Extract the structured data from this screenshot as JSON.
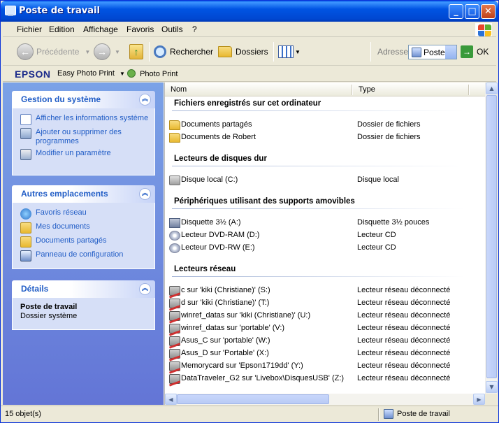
{
  "window": {
    "title": "Poste de travail"
  },
  "menu": [
    "Fichier",
    "Edition",
    "Affichage",
    "Favoris",
    "Outils",
    "?"
  ],
  "toolbar": {
    "back": "Précédente",
    "search": "Rechercher",
    "folders": "Dossiers",
    "address_label": "Adresse",
    "address_value": "Poste",
    "go": "OK"
  },
  "epson": {
    "logo": "EPSON",
    "easy_photo_print": "Easy Photo Print",
    "photo_print": "Photo Print"
  },
  "panels": {
    "system": {
      "title": "Gestion du système",
      "tasks": [
        "Afficher les informations système",
        "Ajouter ou supprimer des programmes",
        "Modifier un paramètre"
      ]
    },
    "places": {
      "title": "Autres emplacements",
      "tasks": [
        "Favoris réseau",
        "Mes documents",
        "Documents partagés",
        "Panneau de configuration"
      ]
    },
    "details": {
      "title": "Détails",
      "name": "Poste de travail",
      "type": "Dossier système"
    }
  },
  "columns": {
    "name": "Nom",
    "type": "Type"
  },
  "groups": {
    "files": {
      "title": "Fichiers enregistrés sur cet ordinateur",
      "items": [
        {
          "name": "Documents partagés",
          "type": "Dossier de fichiers"
        },
        {
          "name": "Documents de Robert",
          "type": "Dossier de fichiers"
        }
      ]
    },
    "hdd": {
      "title": "Lecteurs de disques dur",
      "items": [
        {
          "name": "Disque local (C:)",
          "type": "Disque local"
        }
      ]
    },
    "removable": {
      "title": "Périphériques utilisant des supports amovibles",
      "items": [
        {
          "name": "Disquette 3½ (A:)",
          "type": "Disquette 3½ pouces"
        },
        {
          "name": "Lecteur DVD-RAM (D:)",
          "type": "Lecteur CD"
        },
        {
          "name": "Lecteur DVD-RW (E:)",
          "type": "Lecteur CD"
        }
      ]
    },
    "network": {
      "title": "Lecteurs réseau",
      "items": [
        {
          "name": "c sur 'kiki (Christiane)' (S:)",
          "type": "Lecteur réseau déconnecté"
        },
        {
          "name": "d sur 'kiki (Christiane)' (T:)",
          "type": "Lecteur réseau déconnecté"
        },
        {
          "name": "winref_datas sur 'kiki (Christiane)' (U:)",
          "type": "Lecteur réseau déconnecté"
        },
        {
          "name": "winref_datas sur 'portable' (V:)",
          "type": "Lecteur réseau déconnecté"
        },
        {
          "name": "Asus_C sur 'portable' (W:)",
          "type": "Lecteur réseau déconnecté"
        },
        {
          "name": "Asus_D sur 'Portable' (X:)",
          "type": "Lecteur réseau déconnecté"
        },
        {
          "name": "Memorycard sur 'Epson1719dd' (Y:)",
          "type": "Lecteur réseau déconnecté"
        },
        {
          "name": "DataTraveler_G2 sur 'Livebox\\DisquesUSB' (Z:)",
          "type": "Lecteur réseau déconnecté"
        }
      ]
    }
  },
  "status": {
    "count": "15 objet(s)",
    "location": "Poste de travail"
  }
}
